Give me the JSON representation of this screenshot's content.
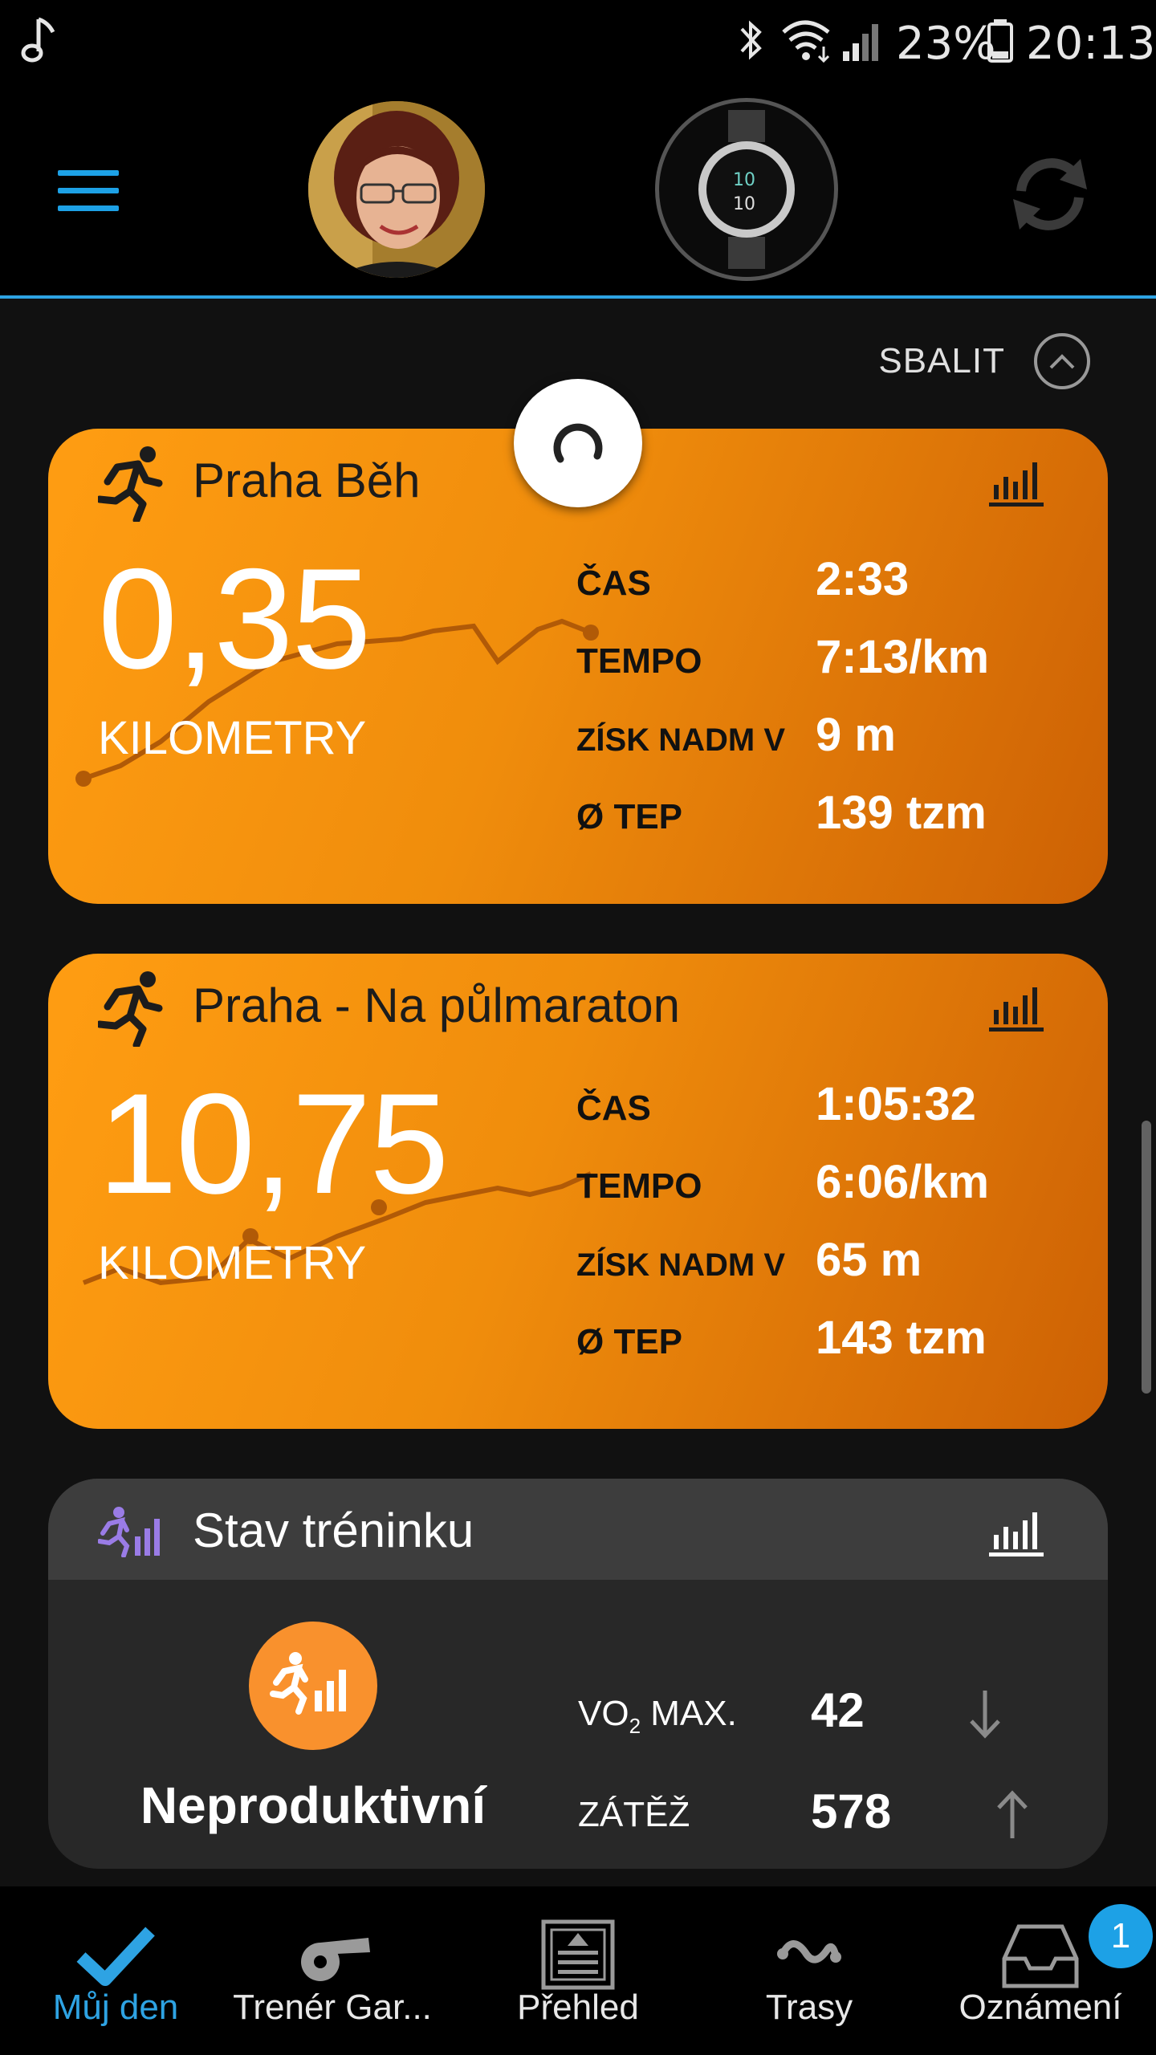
{
  "status_bar": {
    "battery_percent": "23%",
    "time": "20:13"
  },
  "header": {
    "collapse_label": "SBALIT"
  },
  "activities": [
    {
      "title": "Praha Běh",
      "distance": "0,35",
      "distance_unit": "KILOMETRY",
      "stats": [
        {
          "label": "ČAS",
          "value": "2:33"
        },
        {
          "label": "TEMPO",
          "value": "7:13/km"
        },
        {
          "label": "ZÍSK NADM V",
          "value": "9 m"
        },
        {
          "label": "Ø TEP",
          "value": "139 tzm"
        }
      ]
    },
    {
      "title": "Praha - Na půlmaraton",
      "distance": "10,75",
      "distance_unit": "KILOMETRY",
      "stats": [
        {
          "label": "ČAS",
          "value": "1:05:32"
        },
        {
          "label": "TEMPO",
          "value": "6:06/km"
        },
        {
          "label": "ZÍSK NADM V",
          "value": "65 m"
        },
        {
          "label": "Ø TEP",
          "value": "143 tzm"
        }
      ]
    }
  ],
  "training_status": {
    "title": "Stav tréninku",
    "status": "Neproduktivní",
    "vo2_label_prefix": "VO",
    "vo2_label_sub": "2",
    "vo2_label_suffix": " MAX.",
    "vo2_value": "42",
    "vo2_trend": "down",
    "load_label": "ZÁTĚŽ",
    "load_value": "578",
    "load_trend": "up"
  },
  "bottom_nav": {
    "items": [
      {
        "label": "Můj den",
        "icon": "check-icon",
        "active": true
      },
      {
        "label": "Trenér Gar...",
        "icon": "whistle-icon",
        "active": false
      },
      {
        "label": "Přehled",
        "icon": "newspaper-icon",
        "active": false
      },
      {
        "label": "Trasy",
        "icon": "route-icon",
        "active": false
      },
      {
        "label": "Oznámení",
        "icon": "inbox-icon",
        "active": false
      }
    ],
    "notification_count": "1"
  },
  "colors": {
    "accent_blue": "#2ea3e3",
    "activity_orange": "#f08d0c",
    "training_orange": "#f9912d"
  }
}
